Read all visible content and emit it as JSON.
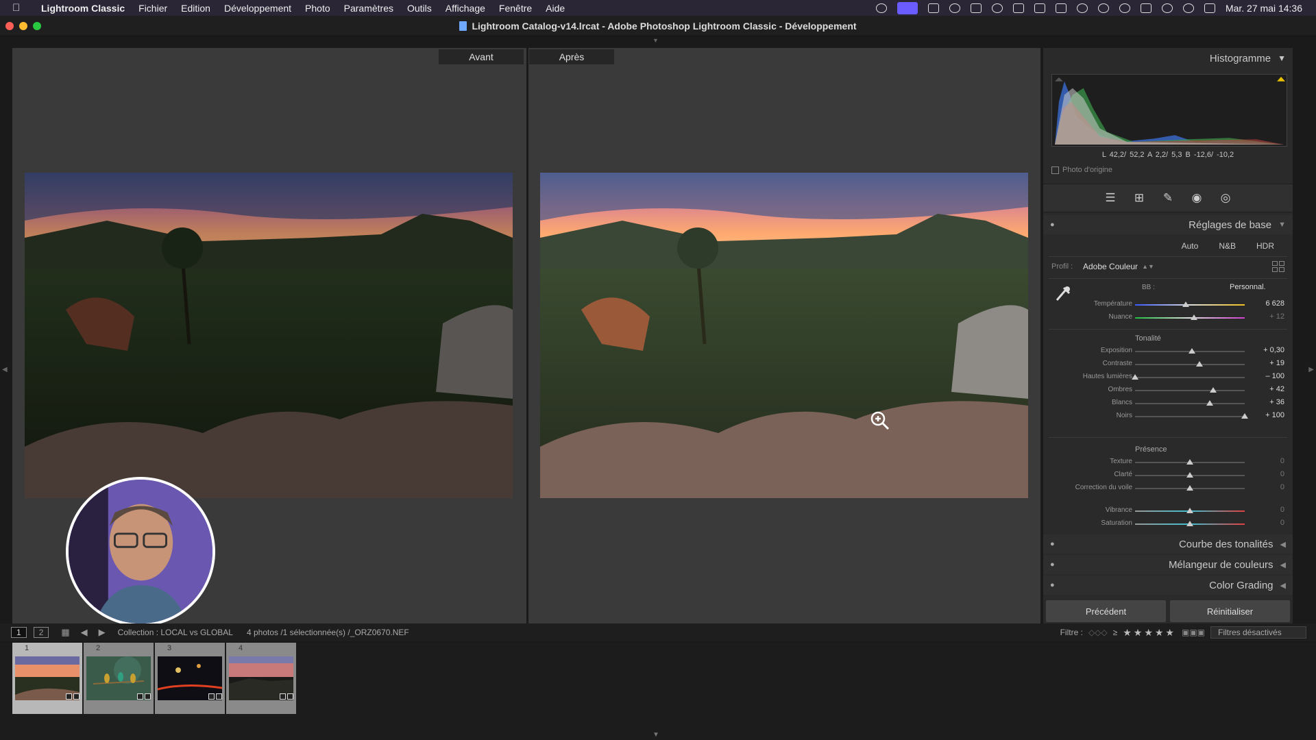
{
  "menubar": {
    "app_name": "Lightroom Classic",
    "items": [
      "Fichier",
      "Edition",
      "Développement",
      "Photo",
      "Paramètres",
      "Outils",
      "Affichage",
      "Fenêtre",
      "Aide"
    ],
    "clock": "Mar. 27 mai  14:36"
  },
  "window": {
    "title": "Lightroom Catalog-v14.lrcat - Adobe Photoshop Lightroom Classic - Développement"
  },
  "view": {
    "before_label": "Avant",
    "after_label": "Après"
  },
  "histogram": {
    "title": "Histogramme",
    "readout": "L  42,2/ 52,2   A   2,2/  5,3  B -12,6/ -10,2",
    "origin_label": "Photo d'origine"
  },
  "basic": {
    "title": "Réglages de base",
    "buttons": [
      "Auto",
      "N&B",
      "HDR"
    ],
    "profile_label": "Profil :",
    "profile_value": "Adobe Couleur",
    "wb_label": "BB :",
    "wb_value": "Personnal.",
    "sliders_wb": [
      {
        "label": "Température",
        "value": "6 628",
        "pos": 0.46,
        "gradient": "temp"
      },
      {
        "label": "Nuance",
        "value": "+ 12",
        "pos": 0.54,
        "gradient": "tint",
        "dim": true
      }
    ],
    "tone_title": "Tonalité",
    "sliders_tone": [
      {
        "label": "Exposition",
        "value": "+ 0,30",
        "pos": 0.52
      },
      {
        "label": "Contraste",
        "value": "+ 19",
        "pos": 0.59
      },
      {
        "label": "Hautes lumières",
        "value": "– 100",
        "pos": 0.0
      },
      {
        "label": "Ombres",
        "value": "+ 42",
        "pos": 0.71
      },
      {
        "label": "Blancs",
        "value": "+ 36",
        "pos": 0.68
      },
      {
        "label": "Noirs",
        "value": "+ 100",
        "pos": 1.0
      }
    ],
    "presence_title": "Présence",
    "sliders_presence": [
      {
        "label": "Texture",
        "value": "0",
        "pos": 0.5,
        "dim": true
      },
      {
        "label": "Clarté",
        "value": "0",
        "pos": 0.5,
        "dim": true
      },
      {
        "label": "Correction du voile",
        "value": "0",
        "pos": 0.5,
        "dim": true
      },
      {
        "label": "Vibrance",
        "value": "0",
        "pos": 0.5,
        "dim": true,
        "gradient": "vib"
      },
      {
        "label": "Saturation",
        "value": "0",
        "pos": 0.5,
        "dim": true,
        "gradient": "vib"
      }
    ]
  },
  "collapsed_sections": [
    "Courbe des tonalités",
    "Mélangeur de couleurs",
    "Color Grading"
  ],
  "actions": {
    "previous": "Précédent",
    "reset": "Réinitialiser"
  },
  "filmbar": {
    "view1": "1",
    "view2": "2",
    "collection": "Collection : LOCAL vs GLOBAL",
    "count": "4 photos /1 sélectionnée(s) /_ORZ0670.NEF",
    "filter_label": "Filtre :",
    "filter_value": "Filtres désactivés"
  },
  "thumbnails": [
    {
      "index": "1",
      "selected": true,
      "scene": "sunset"
    },
    {
      "index": "2",
      "selected": false,
      "scene": "birds"
    },
    {
      "index": "3",
      "selected": false,
      "scene": "night"
    },
    {
      "index": "4",
      "selected": false,
      "scene": "sunset2"
    }
  ],
  "colors": {
    "accent": "#6a5cff",
    "panel_bg": "#2a2a2a",
    "view_bg": "#3a3a3a"
  }
}
